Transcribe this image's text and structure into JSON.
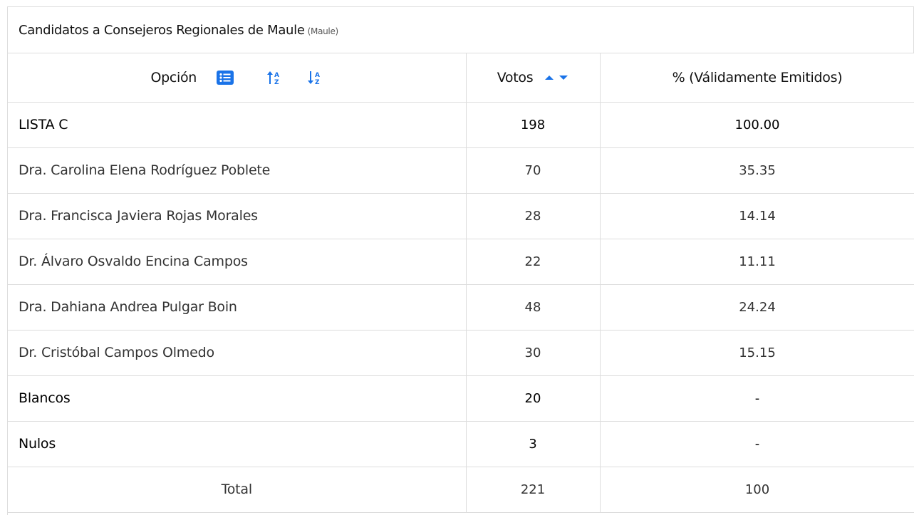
{
  "caption": {
    "title": "Candidatos a Consejeros Regionales de Maule",
    "subtitle": "(Maule)"
  },
  "columns": {
    "option": "Opción",
    "votes": "Votos",
    "percent": "% (Válidamente Emitidos)"
  },
  "icons": {
    "list": "list-icon",
    "sort_asc_alpha": "sort-alpha-up-icon",
    "sort_desc_alpha": "sort-alpha-down-icon",
    "sort_votes": "sort-caret-up-down-icon"
  },
  "accent_color": "#1a73e8",
  "rows": [
    {
      "option": "LISTA C",
      "votes": "198",
      "percent": "100.00"
    },
    {
      "option": "Dra. Carolina Elena Rodríguez Poblete",
      "votes": "70",
      "percent": "35.35"
    },
    {
      "option": "Dra. Francisca Javiera Rojas Morales",
      "votes": "28",
      "percent": "14.14"
    },
    {
      "option": "Dr. Álvaro Osvaldo Encina Campos",
      "votes": "22",
      "percent": "11.11"
    },
    {
      "option": "Dra. Dahiana Andrea Pulgar Boin",
      "votes": "48",
      "percent": "24.24"
    },
    {
      "option": "Dr. Cristóbal Campos Olmedo",
      "votes": "30",
      "percent": "15.15"
    },
    {
      "option": "Blancos",
      "votes": "20",
      "percent": "-"
    },
    {
      "option": "Nulos",
      "votes": "3",
      "percent": "-"
    },
    {
      "option": "Total",
      "votes": "221",
      "percent": "100"
    }
  ]
}
